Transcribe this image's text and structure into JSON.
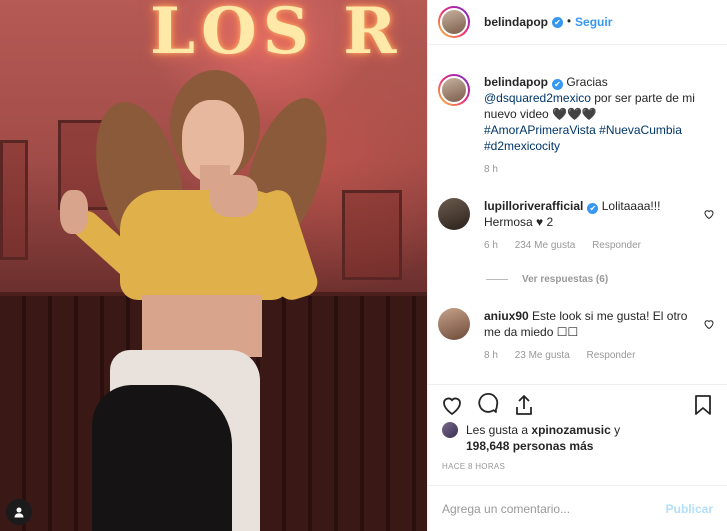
{
  "post": {
    "neon_text": "LOS R",
    "header": {
      "username": "belindapop",
      "verified_mark": "✔",
      "separator": "•",
      "follow_label": "Seguir"
    },
    "caption": {
      "username": "belindapop",
      "text_1": "Gracias",
      "mention": "@dsquared2mexico",
      "text_2": " por ser parte de mi nuevo video 🖤🖤🖤",
      "hashtags": [
        "#AmorAPrimeraVista",
        "#NuevaCumbia",
        "#d2mexicocity"
      ],
      "time": "8 h"
    },
    "comments": [
      {
        "username": "lupilloriverafficial",
        "verified": true,
        "text": "Lolitaaaa!!! Hermosa ♥ 2",
        "time": "6 h",
        "likes": "234 Me gusta",
        "reply_label": "Responder",
        "view_replies": "Ver respuestas (6)"
      },
      {
        "username": "aniux90",
        "verified": false,
        "text": "Este look si me gusta! El otro me da miedo ☐☐",
        "time": "8 h",
        "likes": "23 Me gusta",
        "reply_label": "Responder"
      }
    ],
    "likes_line_1": "Les gusta a ",
    "likes_user": "xpinozamusic",
    "likes_line_2": " y",
    "likes_count": "198,648 personas más",
    "timestamp": "HACE 8 HORAS",
    "comment_placeholder": "Agrega un comentario...",
    "publish_label": "Publicar"
  },
  "icons": {
    "heart": "heart-icon",
    "comment": "comment-icon",
    "share": "share-icon",
    "save": "bookmark-icon",
    "user": "user-icon"
  },
  "colors": {
    "link": "#003569",
    "accent": "#3897f0",
    "muted": "#999999",
    "publish_disabled": "#b2dffc"
  }
}
